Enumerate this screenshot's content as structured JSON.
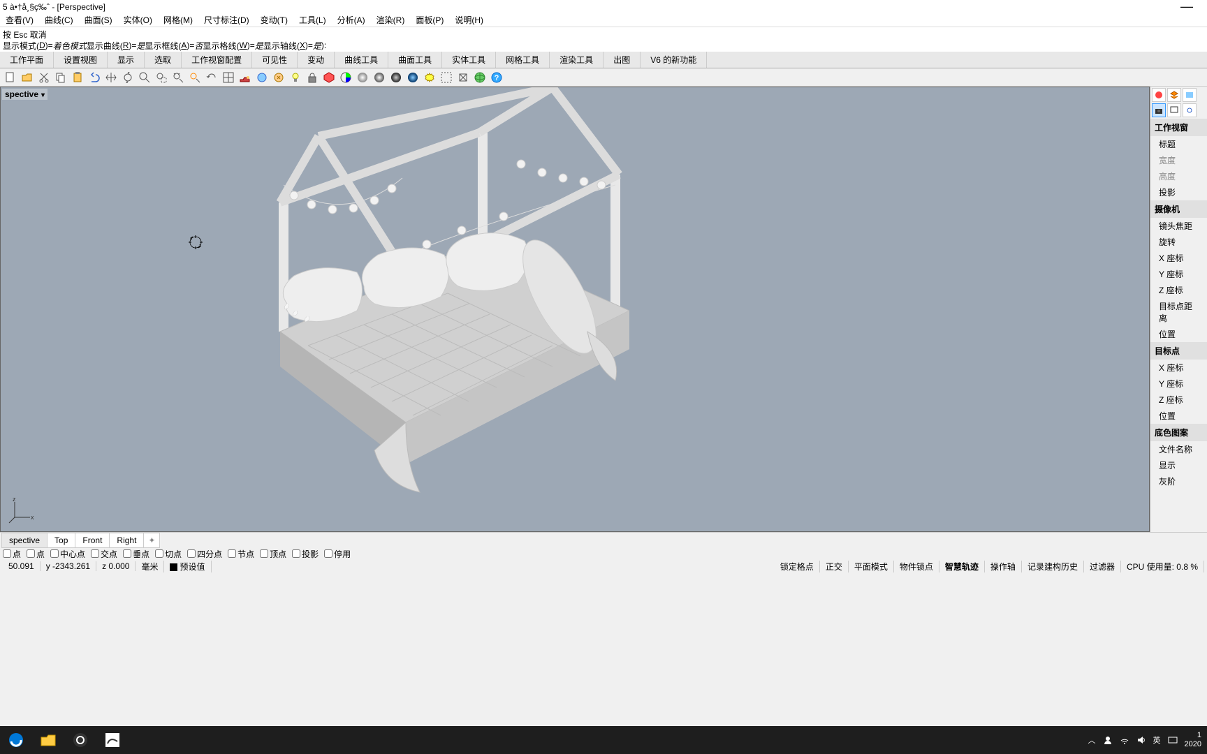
{
  "title": "5 à•†å¸§ç‰ˆ - [Perspective]",
  "menu": [
    "查看(V)",
    "曲线(C)",
    "曲面(S)",
    "实体(O)",
    "网格(M)",
    "尺寸标注(D)",
    "变动(T)",
    "工具(L)",
    "分析(A)",
    "渲染(R)",
    "面板(P)",
    "说明(H)"
  ],
  "command": {
    "line1": "按 Esc 取消",
    "line2_prefix": "显示模式(",
    "line2_d": "D",
    "line2_eq1": ")= ",
    "line2_mode": "着色模式",
    "line2_curves": "  显示曲线(",
    "line2_r": "R",
    "line2_eq2": ")= ",
    "line2_yes1": "是",
    "line2_wires": "  显示框线(",
    "line2_a": "A",
    "line2_eq3": ")= ",
    "line2_no": "否",
    "line2_grid": "  显示格线(",
    "line2_w": "W",
    "line2_eq4": ")= ",
    "line2_yes2": "是",
    "line2_axes": "  显示轴线(",
    "line2_x": "X",
    "line2_eq5": ")= ",
    "line2_yes3": "是",
    "line2_end": " ):"
  },
  "tabs": [
    "工作平面",
    "设置视图",
    "显示",
    "选取",
    "工作视窗配置",
    "可见性",
    "变动",
    "曲线工具",
    "曲面工具",
    "实体工具",
    "网格工具",
    "渲染工具",
    "出图",
    "V6 的新功能"
  ],
  "viewport": {
    "label": "spective",
    "arrow": "▾"
  },
  "view_tabs": [
    "spective",
    "Top",
    "Front",
    "Right"
  ],
  "osnaps": [
    {
      "label": "点",
      "checked": false
    },
    {
      "label": "点",
      "checked": false
    },
    {
      "label": "中心点",
      "checked": false
    },
    {
      "label": "交点",
      "checked": false
    },
    {
      "label": "垂点",
      "checked": false
    },
    {
      "label": "切点",
      "checked": false
    },
    {
      "label": "四分点",
      "checked": false
    },
    {
      "label": "节点",
      "checked": false
    },
    {
      "label": "顶点",
      "checked": false
    },
    {
      "label": "投影",
      "checked": false
    },
    {
      "label": "停用",
      "checked": false
    }
  ],
  "status": {
    "x": "50.091",
    "y": "y -2343.261",
    "z": "z 0.000",
    "units": "毫米",
    "layer": "预设值",
    "grid_snap": "锁定格点",
    "ortho": "正交",
    "planar": "平面模式",
    "osnap": "物件锁点",
    "smart": "智慧轨迹",
    "gumball": "操作轴",
    "history": "记录建构历史",
    "filter": "过滤器",
    "cpu": "CPU 使用量: 0.8 %"
  },
  "props": {
    "sections": [
      {
        "title": "工作视窗",
        "items": [
          {
            "t": "标题",
            "d": false
          },
          {
            "t": "宽度",
            "d": true
          },
          {
            "t": "高度",
            "d": true
          },
          {
            "t": "投影",
            "d": false
          }
        ]
      },
      {
        "title": "摄像机",
        "items": [
          {
            "t": "镜头焦距",
            "d": false
          },
          {
            "t": "旋转",
            "d": false
          },
          {
            "t": "X 座标",
            "d": false
          },
          {
            "t": "Y 座标",
            "d": false
          },
          {
            "t": "Z 座标",
            "d": false
          },
          {
            "t": "目标点距离",
            "d": false
          },
          {
            "t": "位置",
            "d": false
          }
        ]
      },
      {
        "title": "目标点",
        "items": [
          {
            "t": "X 座标",
            "d": false
          },
          {
            "t": "Y 座标",
            "d": false
          },
          {
            "t": "Z 座标",
            "d": false
          },
          {
            "t": "位置",
            "d": false
          }
        ]
      },
      {
        "title": "底色图案",
        "items": [
          {
            "t": "文件名称",
            "d": false
          },
          {
            "t": "显示",
            "d": false
          },
          {
            "t": "灰阶",
            "d": false
          }
        ]
      }
    ]
  },
  "taskbar": {
    "ime": "英",
    "time": "1",
    "date": "2020"
  }
}
